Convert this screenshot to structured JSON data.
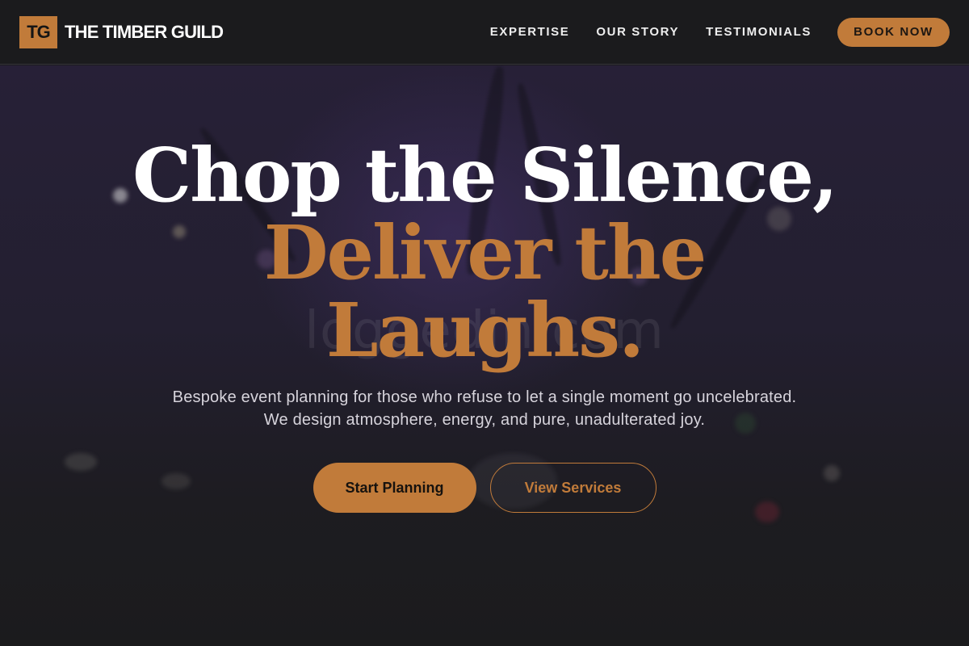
{
  "header": {
    "logo_initials": "TG",
    "brand_name": "THE TIMBER GUILD",
    "nav": [
      {
        "label": "EXPERTISE"
      },
      {
        "label": "OUR STORY"
      },
      {
        "label": "TESTIMONIALS"
      }
    ],
    "book_label": "BOOK NOW"
  },
  "hero": {
    "headline_line1": "Chop the Silence,",
    "headline_line2": "Deliver the",
    "headline_line3": "Laughs.",
    "subtitle_line1": "Bespoke event planning for those who refuse to let a single moment go uncelebrated.",
    "subtitle_line2": "We design atmosphere, energy, and pure, unadulterated joy.",
    "primary_cta": "Start Planning",
    "secondary_cta": "View Services",
    "watermark": "loggedin.com"
  },
  "colors": {
    "accent": "#c17b3a",
    "background": "#1b1b1d",
    "text": "#ffffff"
  }
}
